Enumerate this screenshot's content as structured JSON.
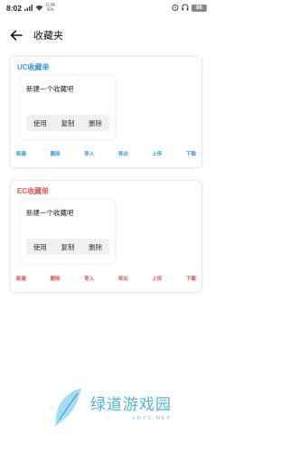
{
  "status_bar": {
    "time": "8:02",
    "net_speed_value": "0.34",
    "net_speed_unit": "K/s",
    "battery": "88"
  },
  "header": {
    "title": "收藏夹"
  },
  "colors": {
    "uc_accent": "#3b9ad9",
    "ec_accent": "#e25555"
  },
  "uc": {
    "title": "UC收藏单",
    "item_text": "新建一个收藏吧",
    "item_actions": [
      "使用",
      "复制",
      "删除"
    ],
    "bottom_actions": [
      "新建",
      "删除",
      "导入",
      "导出",
      "上传",
      "下载"
    ]
  },
  "ec": {
    "title": "EC收藏单",
    "item_text": "新建一个收藏吧",
    "item_actions": [
      "使用",
      "复制",
      "删除"
    ],
    "bottom_actions": [
      "新建",
      "删除",
      "导入",
      "导出",
      "上传",
      "下载"
    ]
  },
  "watermark": {
    "name": "绿道游戏园",
    "url": "LDYC.NET"
  }
}
